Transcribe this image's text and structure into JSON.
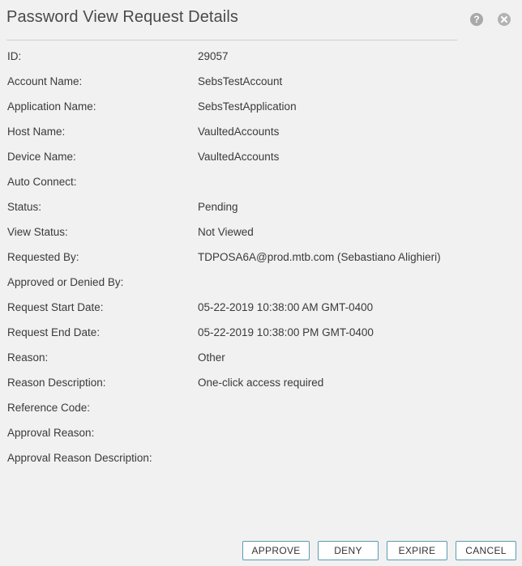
{
  "dialog": {
    "title": "Password View Request Details",
    "help_icon_glyph": "?",
    "icons": {
      "help": "help-icon",
      "close": "close-icon"
    }
  },
  "details": [
    {
      "label": "ID:",
      "value": "29057"
    },
    {
      "label": "Account Name:",
      "value": "SebsTestAccount"
    },
    {
      "label": "Application Name:",
      "value": "SebsTestApplication"
    },
    {
      "label": "Host Name:",
      "value": "VaultedAccounts"
    },
    {
      "label": "Device Name:",
      "value": "VaultedAccounts"
    },
    {
      "label": "Auto Connect:",
      "value": ""
    },
    {
      "label": "Status:",
      "value": "Pending"
    },
    {
      "label": "View Status:",
      "value": "Not Viewed"
    },
    {
      "label": "Requested By:",
      "value": "TDPOSA6A@prod.mtb.com (Sebastiano Alighieri)"
    },
    {
      "label": "Approved or Denied By:",
      "value": ""
    },
    {
      "label": "Request Start Date:",
      "value": "05-22-2019 10:38:00 AM GMT-0400"
    },
    {
      "label": "Request End Date:",
      "value": "05-22-2019 10:38:00 PM GMT-0400"
    },
    {
      "label": "Reason:",
      "value": "Other"
    },
    {
      "label": "Reason Description:",
      "value": "One-click access required"
    },
    {
      "label": "Reference Code:",
      "value": ""
    },
    {
      "label": "Approval Reason:",
      "value": ""
    },
    {
      "label": "Approval Reason Description:",
      "value": ""
    }
  ],
  "buttons": {
    "approve": "APPROVE",
    "deny": "DENY",
    "expire": "EXPIRE",
    "cancel": "CANCEL"
  },
  "colors": {
    "background": "#f1f1f1",
    "button_border": "#5b9bb5",
    "icon_gray": "#a9a9a9"
  }
}
